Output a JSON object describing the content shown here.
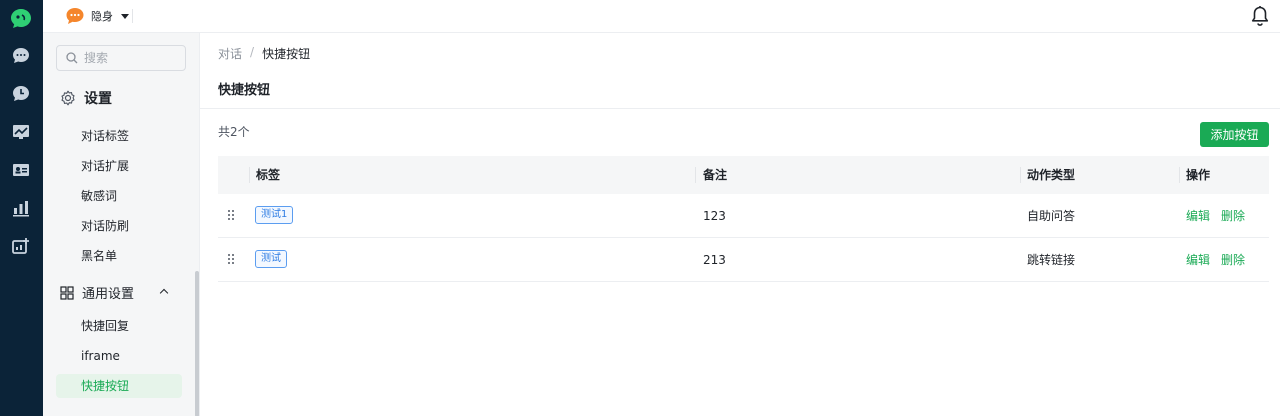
{
  "rail": {
    "icons": [
      "logo-icon",
      "chat-icon",
      "history-icon",
      "monitor-icon",
      "contacts-icon",
      "stats-icon",
      "tools-icon"
    ]
  },
  "topbar": {
    "status_label": "隐身"
  },
  "sidebar": {
    "search_placeholder": "搜索",
    "settings_title": "设置",
    "group1_items": [
      "对话标签",
      "对话扩展",
      "敏感词",
      "对话防刷",
      "黑名单"
    ],
    "general_title": "通用设置",
    "general_items": [
      "快捷回复",
      "iframe",
      "快捷按钮"
    ],
    "active_item": "快捷按钮"
  },
  "main": {
    "breadcrumb_parent": "对话",
    "breadcrumb_sep": "/",
    "breadcrumb_current": "快捷按钮",
    "page_title": "快捷按钮",
    "count_text": "共2个",
    "add_button": "添加按钮",
    "columns": {
      "tag": "标签",
      "remark": "备注",
      "action_type": "动作类型",
      "ops": "操作"
    },
    "rows": [
      {
        "tag": "测试1",
        "remark": "123",
        "action_type": "自助问答",
        "edit": "编辑",
        "delete": "删除"
      },
      {
        "tag": "测试",
        "remark": "213",
        "action_type": "跳转链接",
        "edit": "编辑",
        "delete": "删除"
      }
    ]
  },
  "colors": {
    "rail_bg": "#0b2338",
    "accent_green": "#1aaa55",
    "tag_blue": "#2e7ce3",
    "status_orange": "#f5862c"
  }
}
